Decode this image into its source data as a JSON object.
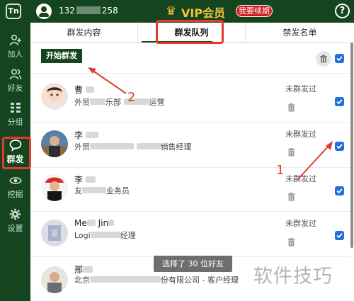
{
  "header": {
    "logo": "Tn",
    "phone_prefix": "132",
    "phone_suffix": "258",
    "vip_crown": "♛",
    "vip_label": "VIP会员",
    "renew_button": "我要续期",
    "help": "?"
  },
  "sidebar": {
    "items": [
      {
        "label": "加人",
        "icon": "add-person-icon"
      },
      {
        "label": "好友",
        "icon": "friends-icon"
      },
      {
        "label": "分组",
        "icon": "grid-icon"
      },
      {
        "label": "群发",
        "icon": "chat-bubble-icon",
        "active": true
      },
      {
        "label": "挖掘",
        "icon": "eye-icon"
      },
      {
        "label": "设置",
        "icon": "gear-icon"
      }
    ]
  },
  "tabs": [
    {
      "label": "群发内容"
    },
    {
      "label": "群发队列",
      "active": true
    },
    {
      "label": "禁发名单"
    }
  ],
  "toolbar": {
    "start_button": "开始群发"
  },
  "friends": [
    {
      "name": "曹",
      "sub_a": "外贸",
      "sub_b": "乐部",
      "sub_c": "运营",
      "status": "未群发过",
      "checked": true
    },
    {
      "name": "李",
      "sub_a": "外贸",
      "sub_b": "销售经理",
      "sub_c": "",
      "status": "未群发过",
      "checked": true
    },
    {
      "name": "李",
      "sub_a": "友",
      "sub_b": "业务员",
      "sub_c": "",
      "status": "未群发过",
      "checked": true
    },
    {
      "name": "Me",
      "name_b": "Jin",
      "sub_a": "Logi",
      "sub_b": "经理",
      "sub_c": "",
      "status": "未群发过",
      "checked": true
    },
    {
      "name": "邢",
      "sub_a": "北京",
      "sub_b": "份有限公司 - 客户经理",
      "sub_c": "",
      "status": "",
      "checked": false
    }
  ],
  "toast": "选择了 30 位好友",
  "watermark": "软件技巧",
  "annotations": [
    "1",
    "2"
  ],
  "colors": {
    "brand": "#14451f",
    "accent": "#f0c23a",
    "highlight": "#e23a2d",
    "checkbox": "#1f6fe0"
  }
}
